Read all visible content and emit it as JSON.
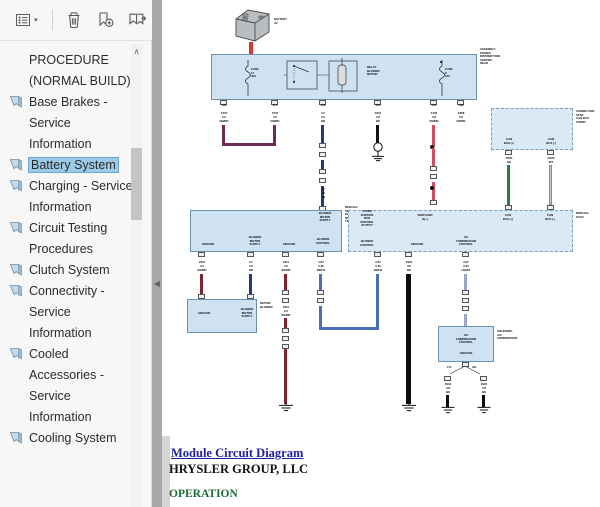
{
  "nav": {
    "toolbar": {
      "options_label": "≡",
      "options_icon": "list-options-icon",
      "delete_icon": "trash-icon",
      "new_bookmark_icon": "new-bookmark-icon",
      "expand_bookmarks_icon": "expand-bookmarks-icon",
      "dropdown_caret": "▾"
    },
    "heading": "PROCEDURE (NORMAL BUILD)",
    "items": [
      {
        "label": "Base Brakes - Service Information",
        "selected": false
      },
      {
        "label": "Battery System",
        "selected": true
      },
      {
        "label": "Charging - Service Information",
        "selected": false
      },
      {
        "label": "Circuit Testing Procedures",
        "selected": false
      },
      {
        "label": "Clutch System",
        "selected": false
      },
      {
        "label": "Connectivity - Service Information",
        "selected": false
      },
      {
        "label": "Cooled Accessories - Service Information",
        "selected": false
      },
      {
        "label": "Cooling System",
        "selected": false
      }
    ],
    "scroll_up_glyph": "∧",
    "splitter_glyph": "◀"
  },
  "document": {
    "link_title": "Module Circuit Diagram",
    "copyright": "HRYSLER GROUP, LLC",
    "section_heading": "OPERATION",
    "colors": {
      "link": "#20209a",
      "heading": "#1d6b33",
      "block_fill": "#cfe2f2",
      "block_stroke": "#6b8fae"
    }
  },
  "schematic": {
    "components": {
      "battery": "BATTERY\nA2",
      "pdc": "ASSEMBLY-\nPOWER\nDISTRIBUTION\nCENTER-\nREAR",
      "fuse_17": "FUSE\n17\n40A",
      "fuse_8": "FUSE\n8\n10A",
      "relay_blower": "RELAY-\nBLOWER\nMOTOR",
      "star_connector": "CONNECTOR-\nSTAR\nCAN BUS\nFRONT",
      "module_power_blower_front": "MODULE-\nPOWER-\nBLOWER-\nMOTOR-\nFRONT",
      "module_hvac": "MODULE-\nHVAC",
      "motor_blower": "MOTOR-\nBLOWER",
      "solenoid_ac_compressor": "SOLENOID-\nA/C\nCOMPRESSOR"
    },
    "block_pins": {
      "power_module": [
        "GROUND",
        "BLOWER\nMOTOR\nSUPPLY",
        "BLOWER\nMOTOR\nSUPPLY",
        "GROUND",
        "BLOWER\nCONTROL"
      ],
      "hvac_module": [
        "FUSED\nIGNITION\nRUN\nCONTROL\nOUTPUT",
        "SWITCHED\nB(+)",
        "CAN\nBUS (+)",
        "CAN\nBUS (-)",
        "BLOWER\nCONTROL",
        "GROUND",
        "A/C\nCOMPRESSOR\nCONTROL"
      ],
      "motor_blower": [
        "GROUND",
        "BLOWER\nMOTOR\nSUPPLY"
      ],
      "solenoid": [
        "A/C\nCOMPRESSOR\nCONTROL",
        "GROUND"
      ]
    },
    "wires": [
      {
        "id": "A707",
        "gauge": "2.0",
        "color_code": "DB/RD",
        "cavity": "12B"
      },
      {
        "id": "A707",
        "gauge": "2.0",
        "color_code": "DB/RD",
        "cavity": "11A"
      },
      {
        "id": "C7",
        "gauge": "2.0",
        "color_code": "DB",
        "cavity": "11B"
      },
      {
        "id": "Z901",
        "gauge": "2.0",
        "color_code": "BK",
        "cavity": "11D"
      },
      {
        "id": "F105",
        "gauge": "0.8",
        "color_code": "RD/DB",
        "cavity": "10C"
      },
      {
        "id": "A808",
        "gauge": "0.8",
        "color_code": "RD/DB",
        "cavity": "10B"
      },
      {
        "id": "D160",
        "gauge": "0.35",
        "color_code": "DG",
        "cavity": "1"
      },
      {
        "id": "D160",
        "gauge": "0.35",
        "color_code": "WT",
        "cavity": "2"
      },
      {
        "id": "Z911",
        "gauge": "2.0",
        "color_code": "BK/RD",
        "cavity": "3"
      },
      {
        "id": "C7",
        "gauge": "2.0",
        "color_code": "DB",
        "cavity": "4"
      },
      {
        "id": "Z911",
        "gauge": "2.0",
        "color_code": "BK/RD",
        "cavity": "5"
      },
      {
        "id": "C94",
        "gauge": "0.35",
        "color_code": "DB/LB",
        "cavity": "6"
      },
      {
        "id": "C94",
        "gauge": "0.35",
        "color_code": "DB/LB",
        "cavity": "7"
      },
      {
        "id": "Z901",
        "gauge": "3.0",
        "color_code": "BK",
        "cavity": "8"
      },
      {
        "id": "C27",
        "gauge": "0.50",
        "color_code": "LB/WT",
        "cavity": "9"
      },
      {
        "id": "Z902",
        "gauge": "0.8",
        "color_code": "BK",
        "cavity": "17L"
      },
      {
        "id": "Z902",
        "gauge": "0.8",
        "color_code": "BK",
        "cavity": "24L"
      }
    ]
  }
}
